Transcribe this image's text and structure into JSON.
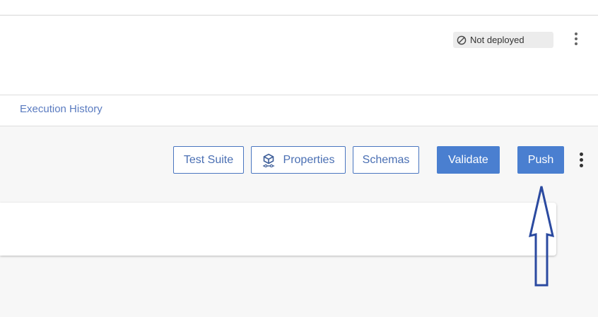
{
  "header": {
    "status": {
      "label": "Not deployed",
      "icon": "not-deployed-icon"
    },
    "menu_icon": "more-vertical-icon"
  },
  "tabs": {
    "execution_history": "Execution History"
  },
  "toolbar": {
    "test_suite_label": "Test Suite",
    "properties_label": "Properties",
    "properties_icon": "properties-icon",
    "schemas_label": "Schemas",
    "validate_label": "Validate",
    "push_label": "Push",
    "menu_icon": "more-vertical-icon"
  },
  "colors": {
    "primary": "#4a7fd0",
    "outline_text": "#4a6fb3",
    "link": "#5a7bc0",
    "annotation_arrow": "#2b4aa0",
    "page_background": "#f7f7f7"
  }
}
